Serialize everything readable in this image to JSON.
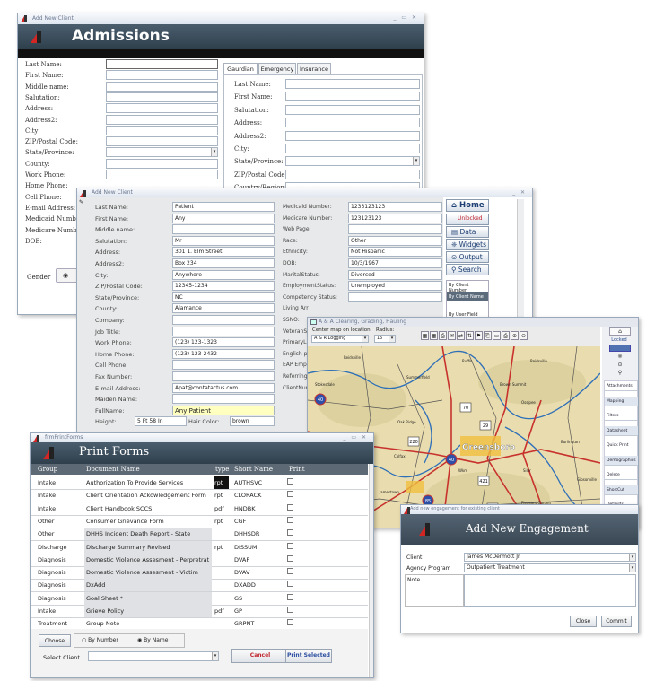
{
  "admissions": {
    "title": "Add New Client",
    "controls": "_ ▭ ✕",
    "header": "Admissions",
    "left_labels": [
      "Last Name:",
      "First Name:",
      "Middle name:",
      "Salutation:",
      "Address:",
      "Address2:",
      "City:",
      "ZIP/Postal Code:",
      "State/Province:",
      "County:",
      "Work Phone:",
      "Home Phone:",
      "Cell Phone:",
      "E-mail Address:",
      "Medicaid Number:",
      "Medicare Number:",
      "DOB:"
    ],
    "gender_label": "Gender",
    "tabs": [
      "Gaurdian",
      "Emergency",
      "Insurance"
    ],
    "right_labels": [
      "Last Name:",
      "First Name:",
      "Salutation:",
      "Address:",
      "Address2:",
      "City:",
      "State/Province:",
      "ZIP/Postal Code:",
      "Country/Region:"
    ]
  },
  "client": {
    "title": "Add New Client",
    "controls": "_ ✕",
    "labels": [
      "Last Name:",
      "First Name:",
      "Middle name:",
      "Salutation:",
      "Address:",
      "Address2:",
      "City:",
      "ZIP/Postal Code:",
      "State/Province:",
      "County:",
      "Company:",
      "Job Title:",
      "Work Phone:",
      "Home Phone:",
      "Cell Phone:",
      "Fax Number:",
      "E-mail Address:",
      "Maiden Name:",
      "FullName:",
      "Height:"
    ],
    "values": [
      "Patient",
      "Any",
      "",
      "Mr",
      "301 1. Elm Street",
      "Box 234",
      "Anywhere",
      "12345-1234",
      "NC",
      "Alamance",
      "",
      "",
      "(123) 123-1323",
      "(123) 123-2432",
      "",
      "",
      "Apat@contatactus.com",
      "",
      "Any Patient",
      "5 Ft 58 In"
    ],
    "hair_color_label": "Hair Color:",
    "hair_color": "brown",
    "mid_labels": [
      "Medicaid Number:",
      "Medicare Number:",
      "Web Page:",
      "Race:",
      "Ethnicity:",
      "DOB:",
      "MaritalStatus:",
      "EmploymentStatus:",
      "Competency Status:",
      "Living Arr",
      "SSNO:",
      "VeteranSt",
      "PrimaryLa",
      "English pr",
      "EAP Emplo",
      "Referring:",
      "ClientNum"
    ],
    "mid_values": [
      "1233123123",
      "123123123",
      "",
      "Other",
      "Not Hispanic",
      "10/3/1967",
      "Divorced",
      "Unemployed",
      "",
      "",
      "",
      "",
      "",
      "",
      "",
      "",
      ""
    ],
    "nav": {
      "home": "Home",
      "unlocked": "Unlocked",
      "data": "Data",
      "widgets": "Widgets",
      "output": "Output",
      "search": "Search"
    },
    "sort_options": [
      "By Client Number",
      "By Client Name",
      "By User Field"
    ]
  },
  "map": {
    "title": "A & A Clearing, Grading, Hauling",
    "center_label": "Center map on location:",
    "radius_label": "Radius:",
    "location": "A & R Logging",
    "radius": "15",
    "city_label": "Greensboro",
    "towns": [
      "Reidsville",
      "Ruffin",
      "Stokesdale",
      "Summerfield",
      "Brown Summit",
      "Reidsville",
      "Ossipee",
      "Oak Ridge",
      "Colfax",
      "Wkm",
      "Colfax",
      "Siler",
      "Kernersville",
      "Jamestown",
      "Pleasant Garden",
      "Burlington",
      "Gibsonville"
    ],
    "shields": [
      "40",
      "220",
      "29",
      "70",
      "85",
      "421",
      "40",
      "29",
      "421"
    ],
    "side_locked": "Locked",
    "side_items": [
      "Attachments",
      "Mapping",
      "Filters",
      "Datasheet",
      "Quick Print",
      "Demographics",
      "Delete",
      "ShortCut",
      "Defaults"
    ]
  },
  "print": {
    "title": "frmPrintForms",
    "controls": "_ ▭ ✕",
    "header": "Print Forms",
    "columns": [
      "Group",
      "Document Name",
      "type",
      "Short Name",
      "Print"
    ],
    "rows": [
      {
        "group": "Intake",
        "doc": "Authorization To Provide Services",
        "type": "rpt",
        "short": "AUTHSVC"
      },
      {
        "group": "Intake",
        "doc": "Client Orientation Ackowledgement Form",
        "type": "rpt",
        "short": "CLORACK"
      },
      {
        "group": "Intake",
        "doc": "Client Handbook SCCS",
        "type": "pdf",
        "short": "HNDBK"
      },
      {
        "group": "Other",
        "doc": "Consumer Grievance Form",
        "type": "rpt",
        "short": "CGF"
      },
      {
        "group": "Other",
        "doc": "DHHS Incident Death Report - State",
        "type": "",
        "short": "DHHSDR"
      },
      {
        "group": "Discharge",
        "doc": "Discharge Summary Revised",
        "type": "rpt",
        "short": "DISSUM"
      },
      {
        "group": "Diagnosis",
        "doc": "Domestic Violence Assesment - Perpretrat",
        "type": "",
        "short": "DVAP"
      },
      {
        "group": "Diagnosis",
        "doc": "Domestic Violence Assesment  - Victim",
        "type": "",
        "short": "DVAV"
      },
      {
        "group": "Diagnosis",
        "doc": "DxAdd",
        "type": "",
        "short": "DXADD"
      },
      {
        "group": "Diagnosis",
        "doc": "Goal Sheet *",
        "type": "",
        "short": "GS"
      },
      {
        "group": "Intake",
        "doc": "Grieve Policy",
        "type": "pdf",
        "short": "GP"
      },
      {
        "group": "Treatment",
        "doc": "Group Note",
        "type": "",
        "short": "GRPNT"
      }
    ],
    "choose": "Choose",
    "by_number": "By Number",
    "by_name": "By Name",
    "select_client": "Select Client",
    "cancel": "Cancel",
    "print_selected": "Print Selected"
  },
  "engagement": {
    "title": "Add new engagement for existing client",
    "header": "Add New Engagement",
    "client_label": "Client",
    "client": "James McDermott Jr",
    "program_label": "Agency Program",
    "program": "Outpatient Treatment",
    "note_label": "Note",
    "close": "Close",
    "commit": "Commit"
  }
}
